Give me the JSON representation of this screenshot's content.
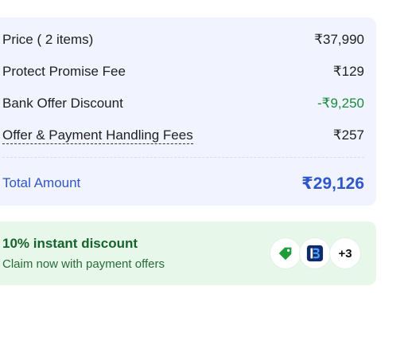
{
  "price_summary": {
    "rows": [
      {
        "label": "Price ( 2 items)",
        "value": "₹37,990"
      },
      {
        "label": "Protect Promise Fee",
        "value": "₹129"
      },
      {
        "label": "Bank Offer Discount",
        "value": "-₹9,250"
      },
      {
        "label": "Offer & Payment Handling Fees",
        "value": "₹257"
      }
    ],
    "total": {
      "label": "Total Amount",
      "value": "₹29,126"
    }
  },
  "offer": {
    "title": "10% instant discount",
    "subtitle": "Claim now with payment offers",
    "badges": {
      "tag_icon": "price-tag-icon",
      "bank_icon": "bank-logo-icon",
      "more_label": "+3"
    }
  },
  "colors": {
    "summary_bg": "#f1f4ff",
    "offer_bg": "#e7f7ea",
    "discount_green": "#1b8a3e",
    "total_blue": "#2f57c9"
  }
}
